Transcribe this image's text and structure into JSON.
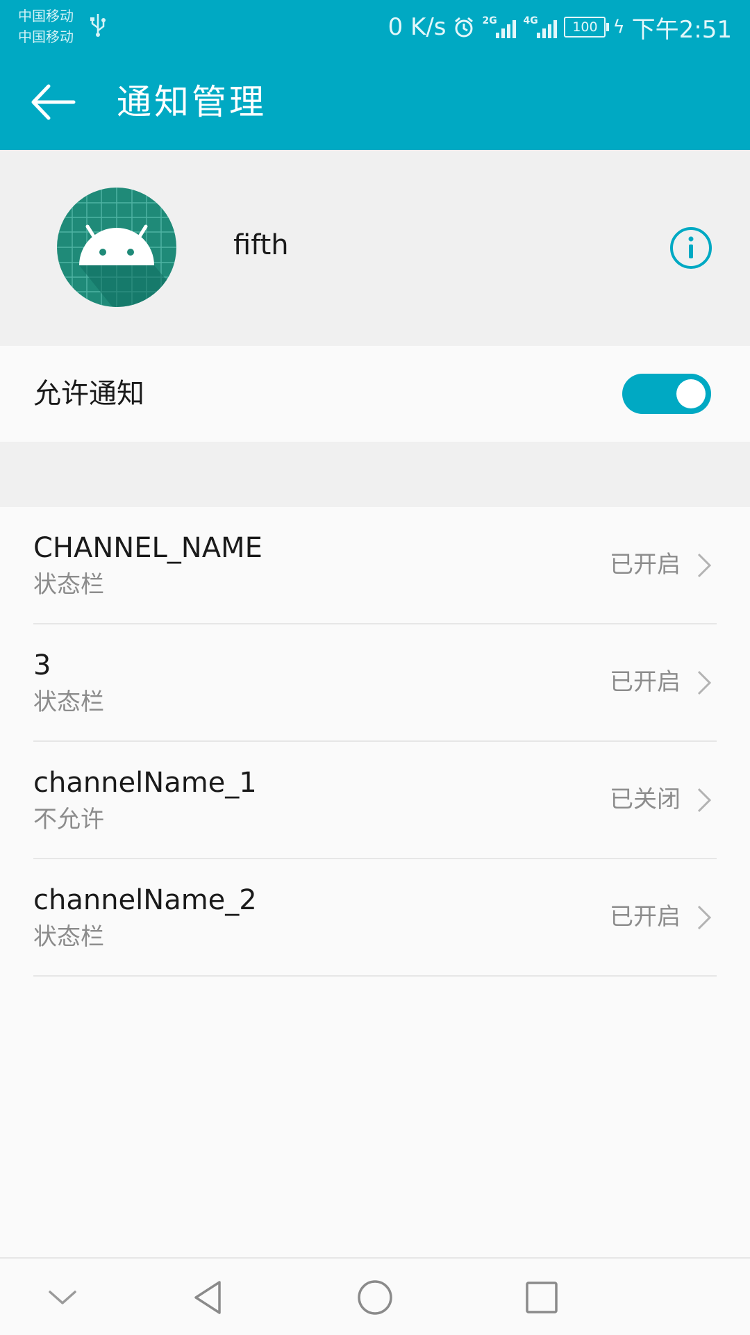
{
  "status_bar": {
    "carrier_1": "中国移动",
    "carrier_2": "中国移动",
    "net_speed": "0 K/s",
    "sim1_network": "2G",
    "sim2_network": "4G",
    "battery": "100",
    "time": "下午2:51"
  },
  "app_bar": {
    "title": "通知管理"
  },
  "app_header": {
    "app_name": "fifth"
  },
  "allow_notifications": {
    "label": "允许通知",
    "enabled": true
  },
  "channels": [
    {
      "name": "CHANNEL_NAME",
      "subtitle": "状态栏",
      "status": "已开启"
    },
    {
      "name": "3",
      "subtitle": "状态栏",
      "status": "已开启"
    },
    {
      "name": "channelName_1",
      "subtitle": "不允许",
      "status": "已关闭"
    },
    {
      "name": "channelName_2",
      "subtitle": "状态栏",
      "status": "已开启"
    }
  ],
  "colors": {
    "accent": "#00a9c3",
    "icon_bg": "#1f8a78"
  }
}
